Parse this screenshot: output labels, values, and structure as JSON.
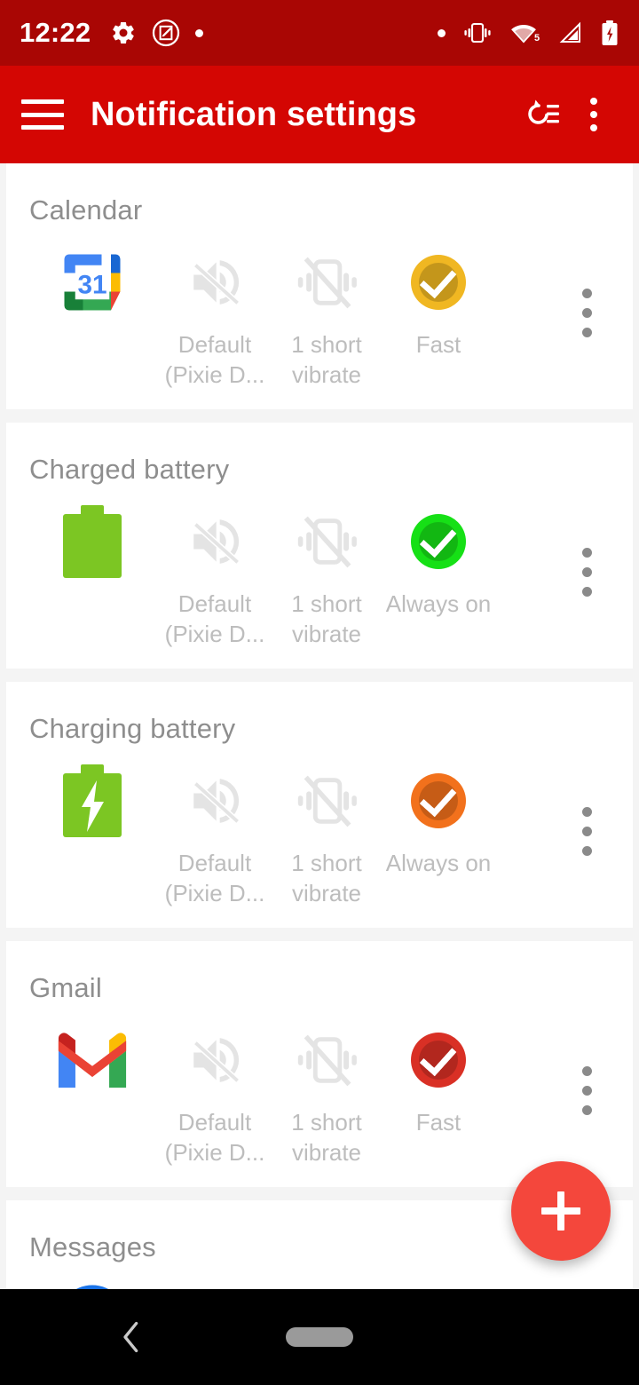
{
  "status_bar": {
    "time": "12:22",
    "left_icons": [
      "gear-icon",
      "screenshot-edit-icon",
      "dot-icon"
    ],
    "right_icons": [
      "dot-icon",
      "vibrate-icon",
      "wifi-icon",
      "signal-icon",
      "battery-charging-icon"
    ],
    "wifi_badge": "5",
    "background_color": "#a90604"
  },
  "app_bar": {
    "menu_label": "menu",
    "title": "Notification settings",
    "action_icon": "refresh-list-icon",
    "overflow_icon": "more-vert-icon",
    "background_color": "#d40603"
  },
  "cards": [
    {
      "title": "Calendar",
      "app_icon": "google-calendar-icon",
      "calendar_day": "31",
      "sound": {
        "icon": "volume-off-icon",
        "label": "Default (Pixie D..."
      },
      "vibration": {
        "icon": "vibration-off-icon",
        "label": "1 short vibrate"
      },
      "led": {
        "icon": "check-circle-icon",
        "label": "Fast",
        "color": "#f0b722"
      },
      "menu_icon": "more-vert-icon"
    },
    {
      "title": "Charged battery",
      "app_icon": "battery-full-icon",
      "sound": {
        "icon": "volume-off-icon",
        "label": "Default (Pixie D..."
      },
      "vibration": {
        "icon": "vibration-off-icon",
        "label": "1 short vibrate"
      },
      "led": {
        "icon": "check-circle-icon",
        "label": "Always on",
        "color": "#16e016"
      },
      "menu_icon": "more-vert-icon"
    },
    {
      "title": "Charging battery",
      "app_icon": "battery-charging-icon",
      "sound": {
        "icon": "volume-off-icon",
        "label": "Default (Pixie D..."
      },
      "vibration": {
        "icon": "vibration-off-icon",
        "label": "1 short vibrate"
      },
      "led": {
        "icon": "check-circle-icon",
        "label": "Always on",
        "color": "#f2711c"
      },
      "menu_icon": "more-vert-icon"
    },
    {
      "title": "Gmail",
      "app_icon": "gmail-icon",
      "sound": {
        "icon": "volume-off-icon",
        "label": "Default (Pixie D..."
      },
      "vibration": {
        "icon": "vibration-off-icon",
        "label": "1 short vibrate"
      },
      "led": {
        "icon": "check-circle-icon",
        "label": "Fast",
        "color": "#d93025"
      },
      "menu_icon": "more-vert-icon"
    },
    {
      "title": "Messages",
      "app_icon": "messages-icon",
      "led": {
        "icon": "check-circle-icon",
        "label": "",
        "color": "#1a73e8"
      }
    }
  ],
  "fab": {
    "icon": "plus-icon",
    "label": "Add",
    "color": "#f4473c"
  },
  "nav_bar": {
    "back_icon": "chevron-left-icon",
    "home_icon": "home-pill-icon"
  }
}
